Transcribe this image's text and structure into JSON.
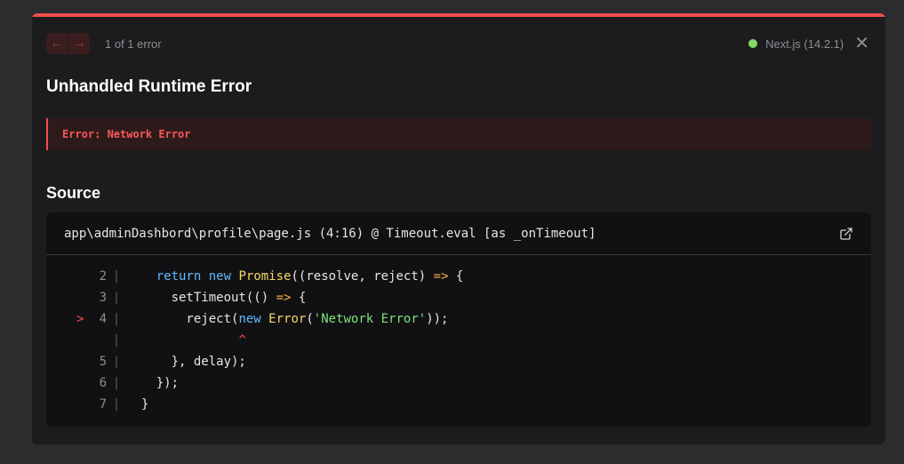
{
  "header": {
    "prev_label": "←",
    "next_label": "→",
    "error_count": "1 of 1 error",
    "version": "Next.js (14.2.1)",
    "close_label": "✕"
  },
  "title": "Unhandled Runtime Error",
  "error_message": "Error: Network Error",
  "source_title": "Source",
  "file_path": "app\\adminDashbord\\profile\\page.js (4:16) @ Timeout.eval [as _onTimeout]",
  "code_lines": [
    {
      "number": "2",
      "marker": "",
      "segments": [
        [
          "    ",
          ""
        ],
        [
          "return",
          "kw"
        ],
        [
          " ",
          ""
        ],
        [
          "new",
          "kw"
        ],
        [
          " ",
          ""
        ],
        [
          "Promise",
          "fn"
        ],
        [
          "((resolve, reject) ",
          ""
        ],
        [
          "=>",
          "op"
        ],
        [
          " {",
          ""
        ]
      ]
    },
    {
      "number": "3",
      "marker": "",
      "segments": [
        [
          "      setTimeout(() ",
          ""
        ],
        [
          "=>",
          "op"
        ],
        [
          " {",
          ""
        ]
      ]
    },
    {
      "number": "4",
      "marker": ">",
      "segments": [
        [
          "        reject(",
          ""
        ],
        [
          "new",
          "kw"
        ],
        [
          " ",
          ""
        ],
        [
          "Error",
          "fn"
        ],
        [
          "(",
          ""
        ],
        [
          "'Network Error'",
          "str"
        ],
        [
          "));",
          ""
        ]
      ]
    },
    {
      "number": "",
      "marker": "",
      "segments": [
        [
          "               ",
          ""
        ],
        [
          "^",
          "caret"
        ]
      ]
    },
    {
      "number": "5",
      "marker": "",
      "segments": [
        [
          "      }, delay);",
          ""
        ]
      ]
    },
    {
      "number": "6",
      "marker": "",
      "segments": [
        [
          "    });",
          ""
        ]
      ]
    },
    {
      "number": "7",
      "marker": "",
      "segments": [
        [
          "  }",
          ""
        ]
      ]
    }
  ],
  "colors": {
    "accent": "#ef4f4f",
    "status_dot": "#82d765",
    "keyword": "#62b8ff",
    "function": "#f5d768",
    "string": "#7fe07c"
  }
}
